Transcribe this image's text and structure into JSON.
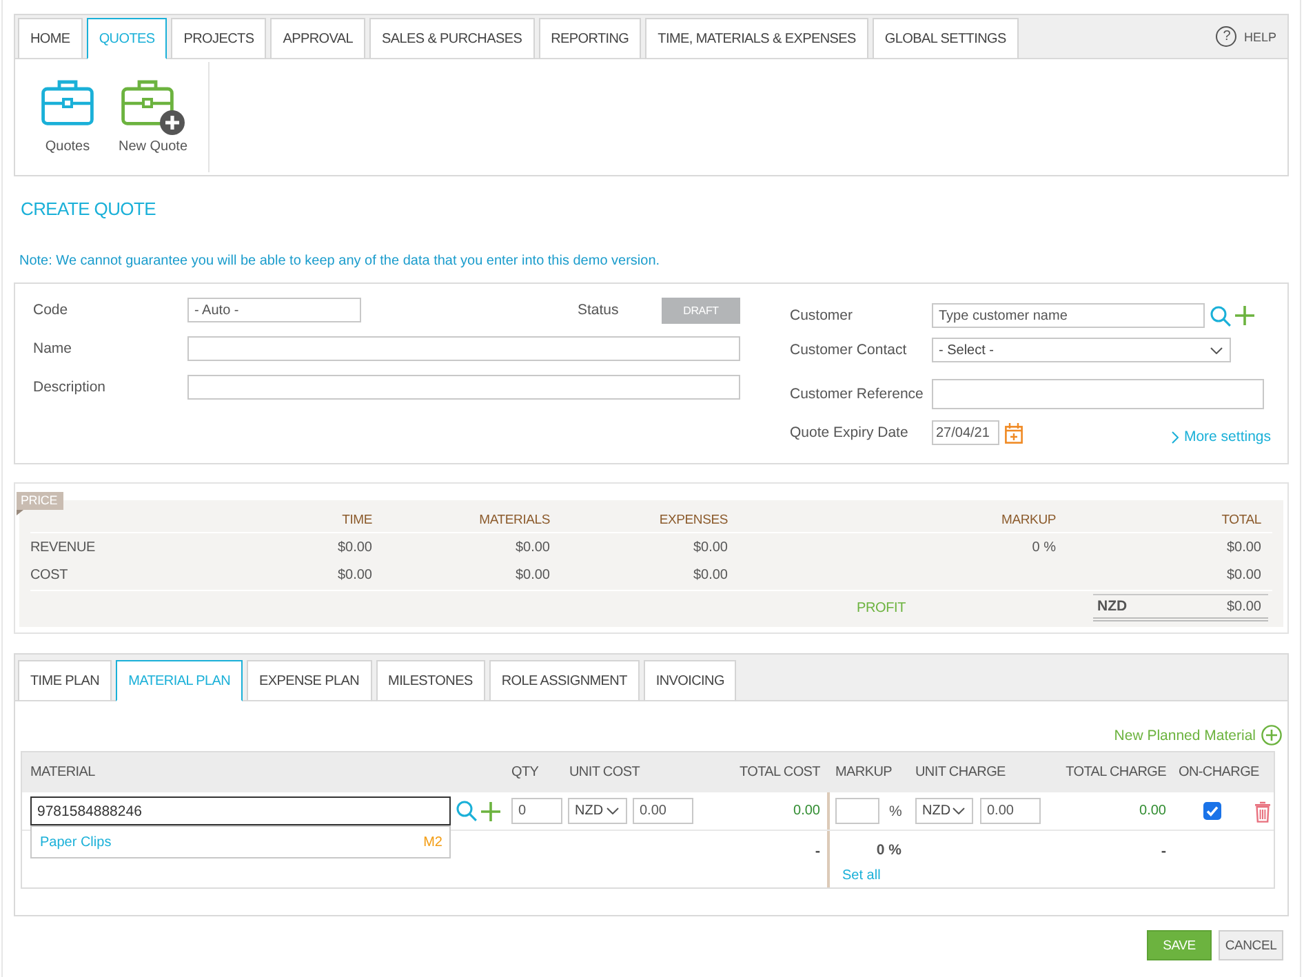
{
  "top_nav": {
    "tabs": [
      {
        "label": "HOME",
        "selected": false
      },
      {
        "label": "QUOTES",
        "selected": true
      },
      {
        "label": "PROJECTS",
        "selected": false
      },
      {
        "label": "APPROVAL",
        "selected": false
      },
      {
        "label": "SALES & PURCHASES",
        "selected": false
      },
      {
        "label": "REPORTING",
        "selected": false
      },
      {
        "label": "TIME, MATERIALS & EXPENSES",
        "selected": false
      },
      {
        "label": "GLOBAL SETTINGS",
        "selected": false
      }
    ],
    "help": {
      "icon": "?",
      "label": "HELP"
    }
  },
  "toolbar": {
    "buttons": [
      {
        "label": "Quotes",
        "kind": "list"
      },
      {
        "label": "New Quote",
        "kind": "new"
      }
    ]
  },
  "page_title": "CREATE QUOTE",
  "note": "Note: We cannot guarantee you will be able to keep any of the data that you enter into this demo version.",
  "quote_form": {
    "code": {
      "label": "Code",
      "placeholder": "- Auto -"
    },
    "name": {
      "label": "Name"
    },
    "description": {
      "label": "Description"
    },
    "status": {
      "label": "Status",
      "value": "DRAFT"
    },
    "customer": {
      "label": "Customer",
      "placeholder": "Type customer name"
    },
    "customer_contact": {
      "label": "Customer Contact",
      "value": "- Select -"
    },
    "customer_reference": {
      "label": "Customer Reference"
    },
    "quote_expiry_date": {
      "label": "Quote Expiry Date",
      "value": "27/04/21"
    },
    "more_settings": "More settings"
  },
  "price": {
    "tag": "PRICE",
    "columns": [
      "TIME",
      "MATERIALS",
      "EXPENSES",
      "MARKUP",
      "TOTAL"
    ],
    "rows": [
      {
        "label": "REVENUE",
        "cells": [
          "$0.00",
          "$0.00",
          "$0.00",
          "0 %",
          "$0.00"
        ]
      },
      {
        "label": "COST",
        "cells": [
          "$0.00",
          "$0.00",
          "$0.00",
          null,
          "$0.00"
        ]
      }
    ],
    "profit": {
      "label": "PROFIT",
      "currency": "NZD",
      "total": "$0.00"
    }
  },
  "plan_tabs": [
    {
      "label": "TIME PLAN",
      "selected": false
    },
    {
      "label": "MATERIAL PLAN",
      "selected": true
    },
    {
      "label": "EXPENSE PLAN",
      "selected": false
    },
    {
      "label": "MILESTONES",
      "selected": false
    },
    {
      "label": "ROLE ASSIGNMENT",
      "selected": false
    },
    {
      "label": "INVOICING",
      "selected": false
    }
  ],
  "material_plan": {
    "new_link": "New Planned Material",
    "columns": [
      "MATERIAL",
      "QTY",
      "UNIT COST",
      "TOTAL COST",
      "MARKUP",
      "UNIT CHARGE",
      "TOTAL CHARGE",
      "ON-CHARGE"
    ],
    "rows": [
      {
        "material": "9781584888246",
        "focused": true,
        "qty": "0",
        "cost_currency": "NZD",
        "unit_cost": "0.00",
        "total_cost": "0.00",
        "markup_unit": "%",
        "charge_currency": "NZD",
        "unit_charge": "0.00",
        "total_charge": "0.00",
        "on_charge": true
      }
    ],
    "suggestions": [
      {
        "name": "Paper Clips",
        "code": "M2"
      }
    ],
    "totals": {
      "total_cost": "-",
      "markup": "0 %",
      "set_all": "Set all",
      "total_charge": "-"
    }
  },
  "actions": [
    {
      "label": "SAVE",
      "kind": "primary"
    },
    {
      "label": "CANCEL",
      "kind": "secondary"
    }
  ]
}
